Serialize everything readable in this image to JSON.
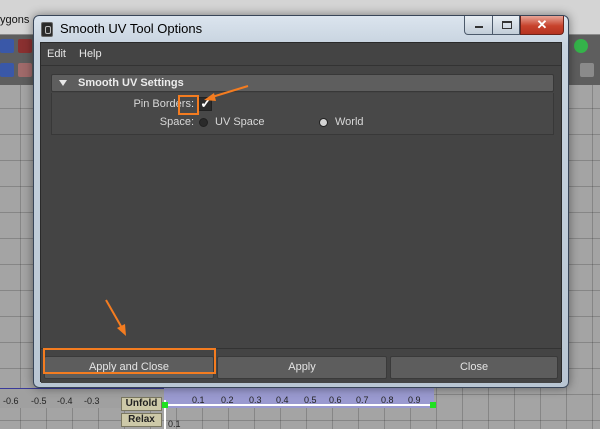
{
  "background": {
    "menu_fragment": "ygons",
    "ruler_ticks_left": [
      "-0.6",
      "-0.5",
      "-0.4",
      "-0.3"
    ],
    "ruler_ticks_right": [
      "0.1",
      "0.2",
      "0.3",
      "0.4",
      "0.5",
      "0.6",
      "0.7",
      "0.8",
      "0.9"
    ],
    "bottom_tick": "0.1",
    "unfold_label": "Unfold",
    "relax_label": "Relax"
  },
  "window": {
    "title": "Smooth UV Tool Options",
    "close_glyph": "✕",
    "menu": [
      "Edit",
      "Help"
    ]
  },
  "settings": {
    "section_title": "Smooth UV Settings",
    "pin_borders_label": "Pin Borders:",
    "pin_borders_checked": true,
    "check_glyph": "✓",
    "space_label": "Space:",
    "space_options": [
      "UV Space",
      "World"
    ],
    "space_selected": "World"
  },
  "buttons": {
    "apply_and_close": "Apply and Close",
    "apply": "Apply",
    "close": "Close"
  },
  "colors": {
    "annotation": "#f47c20",
    "dialog_bg": "#444444",
    "button_bg": "#5d5d5d"
  }
}
